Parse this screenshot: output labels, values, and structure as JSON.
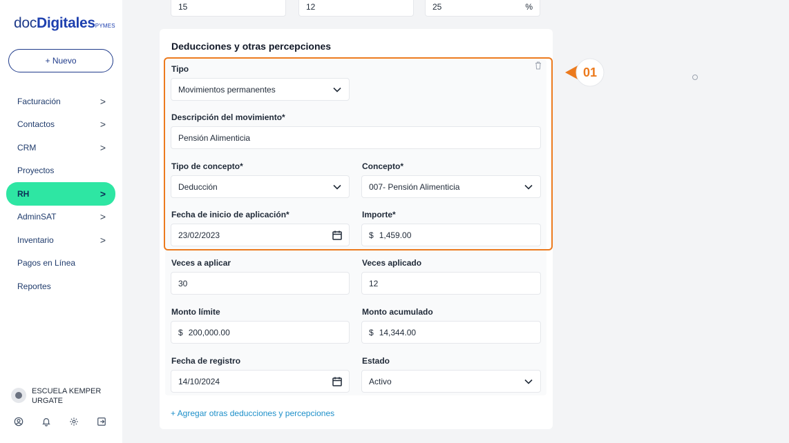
{
  "sidebar": {
    "logo": {
      "part1": "doc",
      "part2": "Digitales",
      "part3": "PYMES"
    },
    "new_button": "+ Nuevo",
    "items": [
      {
        "label": "Facturación",
        "chevron": ">"
      },
      {
        "label": "Contactos",
        "chevron": ">"
      },
      {
        "label": "CRM",
        "chevron": ">"
      },
      {
        "label": "Proyectos",
        "chevron": ""
      },
      {
        "label": "RH",
        "chevron": ">"
      },
      {
        "label": "AdminSAT",
        "chevron": ">"
      },
      {
        "label": "Inventario",
        "chevron": ">"
      },
      {
        "label": "Pagos en Línea",
        "chevron": ""
      },
      {
        "label": "Reportes",
        "chevron": ""
      }
    ],
    "org_name": "ESCUELA KEMPER URGATE"
  },
  "top_row": {
    "field1": "15",
    "field2": "12",
    "field3": "25",
    "field3_suffix": "%"
  },
  "section": {
    "title": "Deducciones y otras percepciones",
    "tipo_label": "Tipo",
    "tipo_value": "Movimientos permanentes",
    "descripcion_label": "Descripción del movimiento*",
    "descripcion_value": "Pensión Alimenticia",
    "tipo_concepto_label": "Tipo de concepto*",
    "tipo_concepto_value": "Deducción",
    "concepto_label": "Concepto*",
    "concepto_value": "007- Pensión Alimenticia",
    "fecha_inicio_label": "Fecha de inicio de aplicación*",
    "fecha_inicio_value": "23/02/2023",
    "importe_label": "Importe*",
    "importe_prefix": "$",
    "importe_value": "1,459.00",
    "veces_aplicar_label": "Veces a aplicar",
    "veces_aplicar_value": "30",
    "veces_aplicado_label": "Veces aplicado",
    "veces_aplicado_value": "12",
    "monto_limite_label": "Monto límite",
    "monto_limite_prefix": "$",
    "monto_limite_value": "200,000.00",
    "monto_acumulado_label": "Monto acumulado",
    "monto_acumulado_prefix": "$",
    "monto_acumulado_value": "14,344.00",
    "fecha_registro_label": "Fecha de registro",
    "fecha_registro_value": "14/10/2024",
    "estado_label": "Estado",
    "estado_value": "Activo",
    "add_link": "+ Agregar otras deducciones y percepciones"
  },
  "callout": {
    "number": "01",
    "color": "#ec7a1d"
  },
  "colors": {
    "accent_green": "#2ee6a3",
    "brand_blue": "#1e3a8a",
    "link_blue": "#1d8fc9",
    "highlight_orange": "#ec7a1d"
  }
}
